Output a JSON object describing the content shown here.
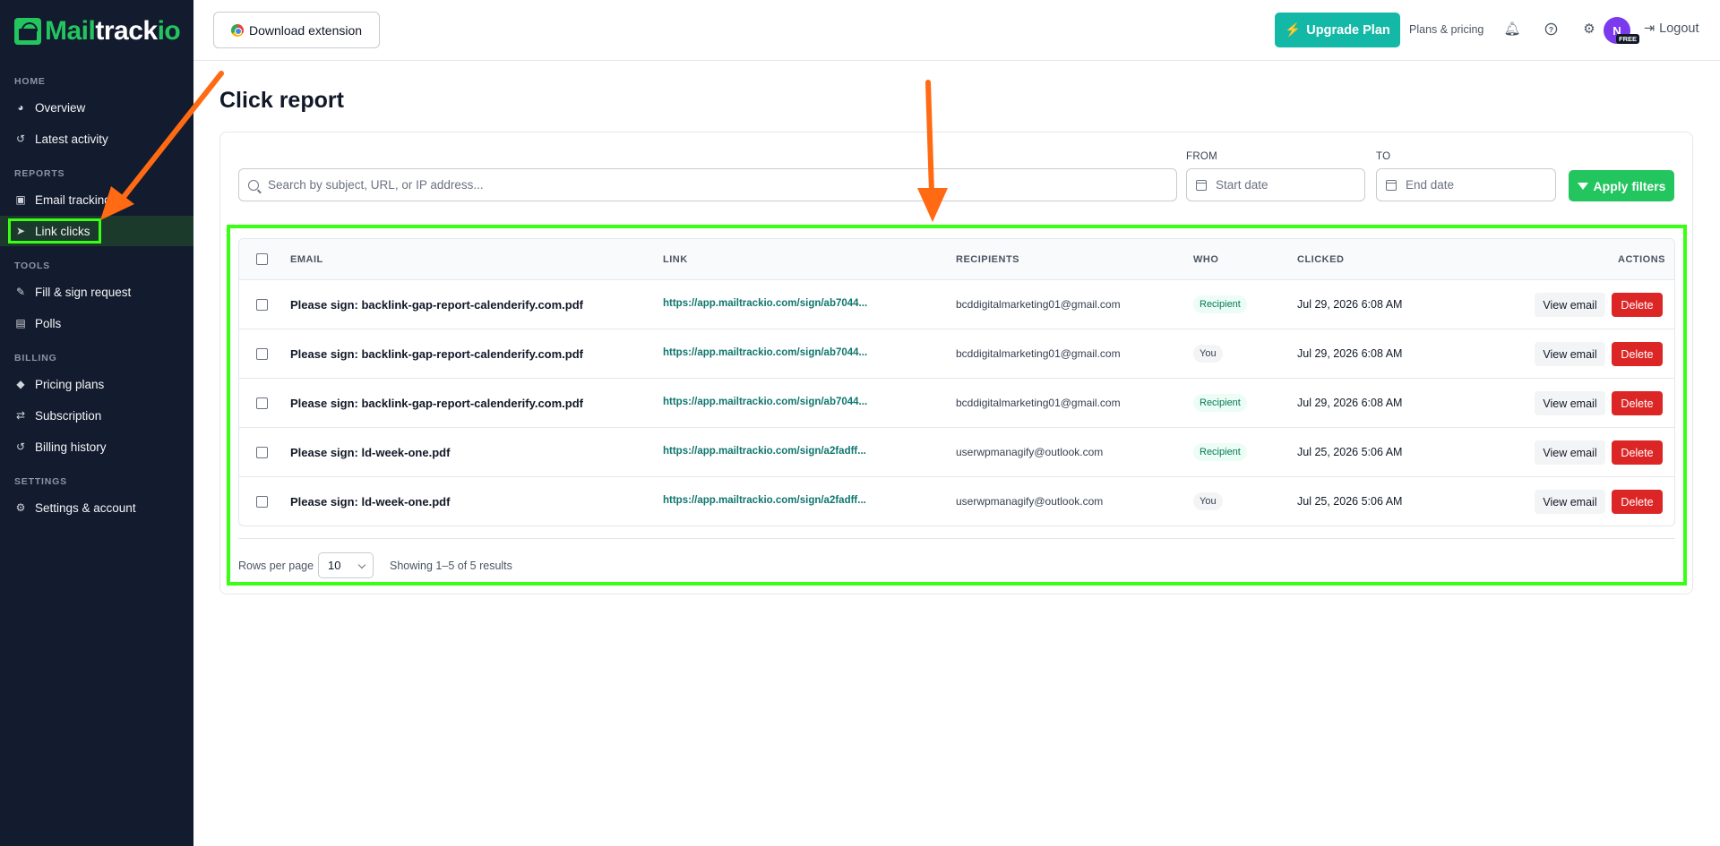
{
  "brand": {
    "part1": "Mail",
    "part2": "track",
    "part3": "io"
  },
  "sidebar": {
    "sections": [
      {
        "title": "HOME"
      },
      {
        "title": "REPORTS"
      },
      {
        "title": "TOOLS"
      },
      {
        "title": "BILLING"
      },
      {
        "title": "SETTINGS"
      }
    ],
    "items": [
      {
        "label": "Overview",
        "icon": "gauge-icon"
      },
      {
        "label": "Latest activity",
        "icon": "history-icon"
      },
      {
        "label": "Email tracking",
        "icon": "inbox-icon"
      },
      {
        "label": "Link clicks",
        "icon": "cursor-icon",
        "active": true
      },
      {
        "label": "Fill & sign request",
        "icon": "signature-icon"
      },
      {
        "label": "Polls",
        "icon": "poll-icon"
      },
      {
        "label": "Pricing plans",
        "icon": "tags-icon"
      },
      {
        "label": "Subscription",
        "icon": "repeat-icon"
      },
      {
        "label": "Billing history",
        "icon": "history-icon"
      },
      {
        "label": "Settings & account",
        "icon": "gear-icon"
      }
    ]
  },
  "topbar": {
    "download_label": "Download extension",
    "upgrade_label": "Upgrade Plan",
    "plans_label": "Plans & pricing",
    "avatar_initial": "N",
    "plan_badge": "FREE",
    "logout_label": "Logout"
  },
  "page": {
    "title": "Click report",
    "search_placeholder": "Search by subject, URL, or IP address...",
    "from_label": "FROM",
    "to_label": "TO",
    "start_placeholder": "Start date",
    "end_placeholder": "End date",
    "apply_label": "Apply filters"
  },
  "table": {
    "headers": {
      "email": "EMAIL",
      "link": "LINK",
      "recipients": "RECIPIENTS",
      "who": "WHO",
      "clicked": "CLICKED",
      "actions": "ACTIONS"
    },
    "view_label": "View email",
    "delete_label": "Delete",
    "rows": [
      {
        "email": "Please sign: backlink-gap-report-calenderify.com.pdf",
        "link": "https://app.mailtrackio.com/sign/ab7044...",
        "recipient": "bcddigitalmarketing01@gmail.com",
        "who": "Recipient",
        "clicked": "Jul 29, 2026 6:08 AM"
      },
      {
        "email": "Please sign: backlink-gap-report-calenderify.com.pdf",
        "link": "https://app.mailtrackio.com/sign/ab7044...",
        "recipient": "bcddigitalmarketing01@gmail.com",
        "who": "You",
        "clicked": "Jul 29, 2026 6:08 AM"
      },
      {
        "email": "Please sign: backlink-gap-report-calenderify.com.pdf",
        "link": "https://app.mailtrackio.com/sign/ab7044...",
        "recipient": "bcddigitalmarketing01@gmail.com",
        "who": "Recipient",
        "clicked": "Jul 29, 2026 6:08 AM"
      },
      {
        "email": "Please sign: ld-week-one.pdf",
        "link": "https://app.mailtrackio.com/sign/a2fadff...",
        "recipient": "userwpmanagify@outlook.com",
        "who": "Recipient",
        "clicked": "Jul 25, 2026 5:06 AM"
      },
      {
        "email": "Please sign: ld-week-one.pdf",
        "link": "https://app.mailtrackio.com/sign/a2fadff...",
        "recipient": "userwpmanagify@outlook.com",
        "who": "You",
        "clicked": "Jul 25, 2026 5:06 AM"
      }
    ]
  },
  "pagination": {
    "rows_per_page_label": "Rows per page",
    "rows_per_page_value": "10",
    "showing": "Showing 1–5 of 5 results"
  },
  "colors": {
    "accent": "#22c55e",
    "teal": "#14b8a6",
    "sidebar_bg": "#131b2e",
    "highlight": "#39ff14",
    "annotation_arrow": "#ff6a13",
    "delete": "#dc2626"
  }
}
